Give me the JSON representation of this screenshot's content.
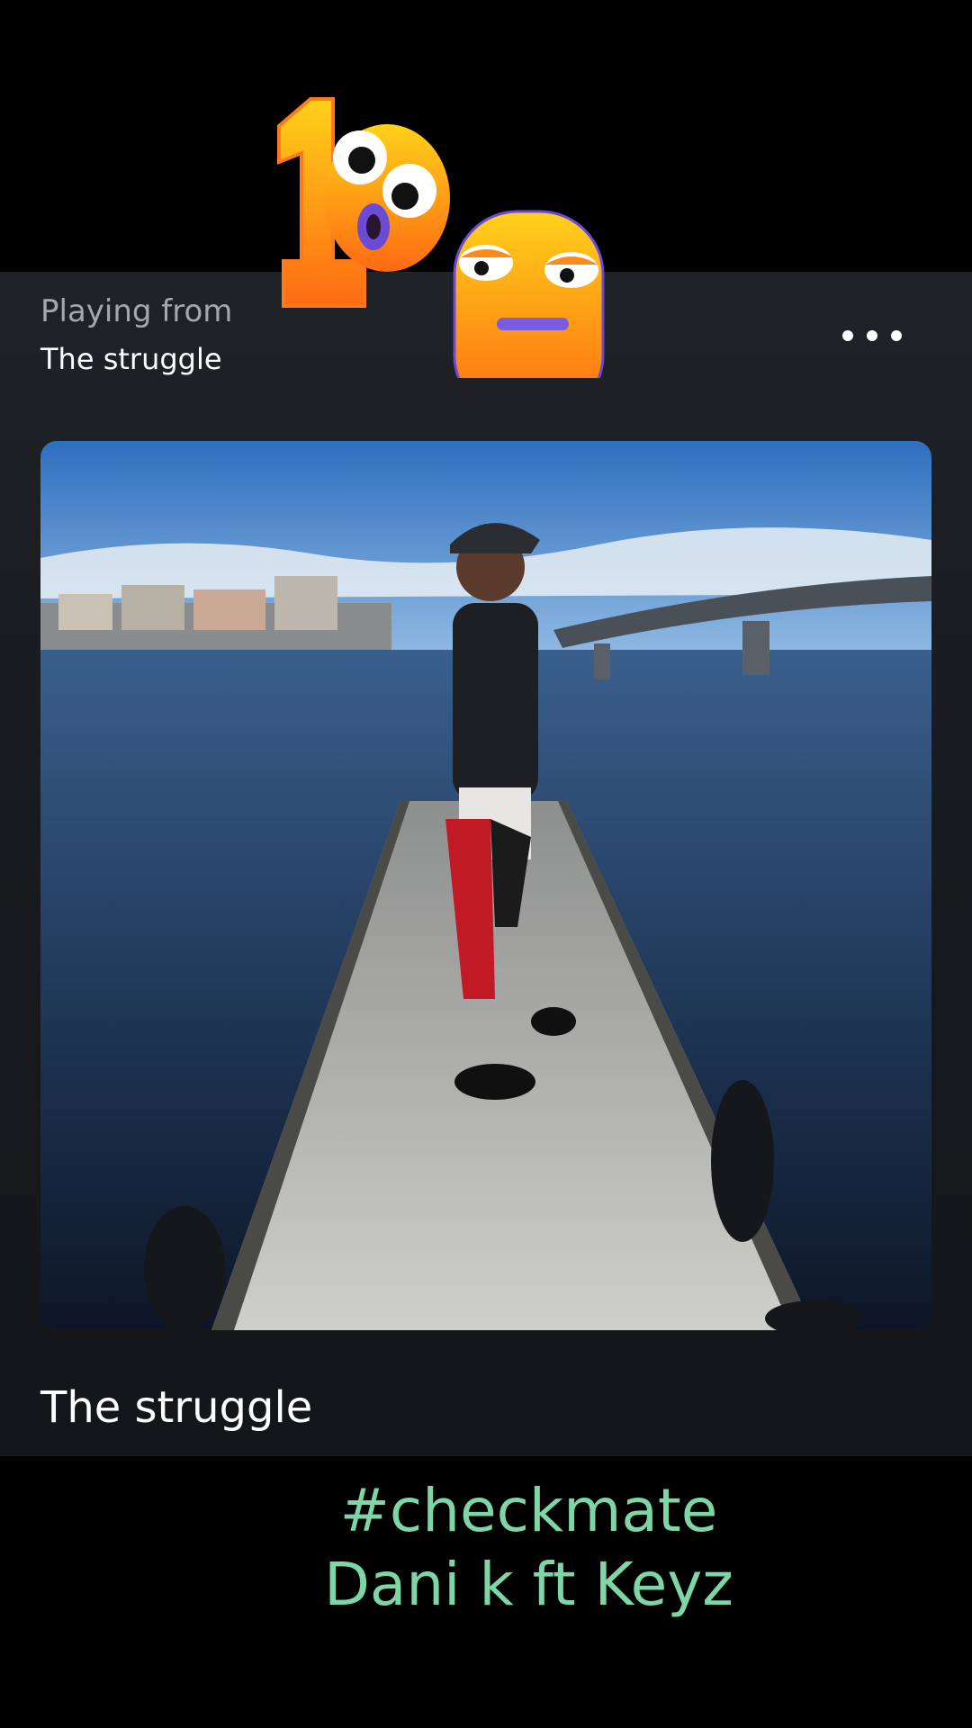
{
  "player": {
    "playing_from_label": "Playing from",
    "playing_from_source": "The struggle",
    "more_icon": "more-horizontal-icon",
    "track_title": "The struggle"
  },
  "overlay": {
    "caption_line1": "#checkmate",
    "caption_line2": "Dani k ft Keyz",
    "sticker": "hundred-emoji-sticker"
  },
  "colors": {
    "caption": "#7ed6a7",
    "background": "#000000",
    "panel": "#1c1f23"
  }
}
